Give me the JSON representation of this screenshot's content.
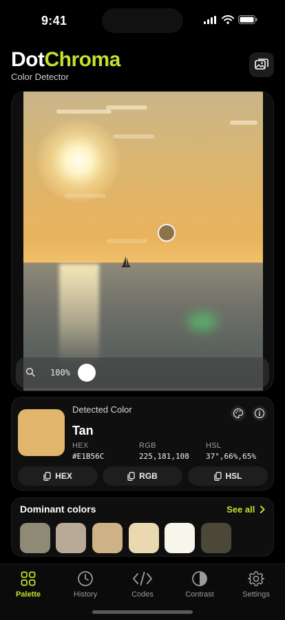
{
  "status": {
    "time": "9:41"
  },
  "header": {
    "title_part1": "Dot",
    "title_part2": "Chroma",
    "subtitle": "Color Detector"
  },
  "viewer": {
    "zoom_label": "100%"
  },
  "detected": {
    "label": "Detected Color",
    "name": "Tan",
    "color": "#E1B56C",
    "hex_key": "HEX",
    "hex_value": "#E1B56C",
    "rgb_key": "RGB",
    "rgb_value": "225,181,108",
    "hsl_key": "HSL",
    "hsl_value": "37°,66%,65%",
    "copy_hex": "HEX",
    "copy_rgb": "RGB",
    "copy_hsl": "HSL"
  },
  "dominant": {
    "title": "Dominant colors",
    "see_all": "See all",
    "swatches": [
      "#8e8a76",
      "#b7ab98",
      "#cfb187",
      "#ead8b1",
      "#f8f6ea",
      "#4b4838"
    ]
  },
  "tabs": [
    {
      "label": "Palette",
      "icon": "grid-icon"
    },
    {
      "label": "History",
      "icon": "clock-icon"
    },
    {
      "label": "Codes",
      "icon": "code-icon"
    },
    {
      "label": "Contrast",
      "icon": "contrast-icon"
    },
    {
      "label": "Settings",
      "icon": "gear-icon"
    }
  ],
  "colors": {
    "accent": "#c3e02e",
    "background": "#000000"
  }
}
